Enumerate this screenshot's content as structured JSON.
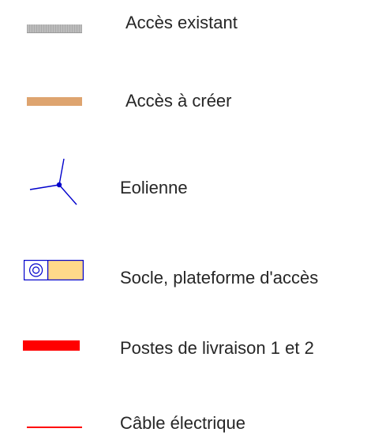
{
  "legend": {
    "items": [
      {
        "label": "Accès existant",
        "color": "#b4b4b4",
        "symbol": "grey-road-bar"
      },
      {
        "label": "Accès à créer",
        "color": "#dea46f",
        "symbol": "tan-road-bar"
      },
      {
        "label": "Eolienne",
        "color": "#0000cc",
        "symbol": "wind-turbine-icon"
      },
      {
        "label": "Socle, plateforme d'accès",
        "color": "#ffd98a",
        "symbol": "socle-platform-icon"
      },
      {
        "label": "Postes de livraison 1 et 2",
        "color": "#ff0000",
        "symbol": "red-thick-bar"
      },
      {
        "label": "Câble électrique",
        "color": "#ff0000",
        "symbol": "red-thin-line"
      }
    ]
  }
}
